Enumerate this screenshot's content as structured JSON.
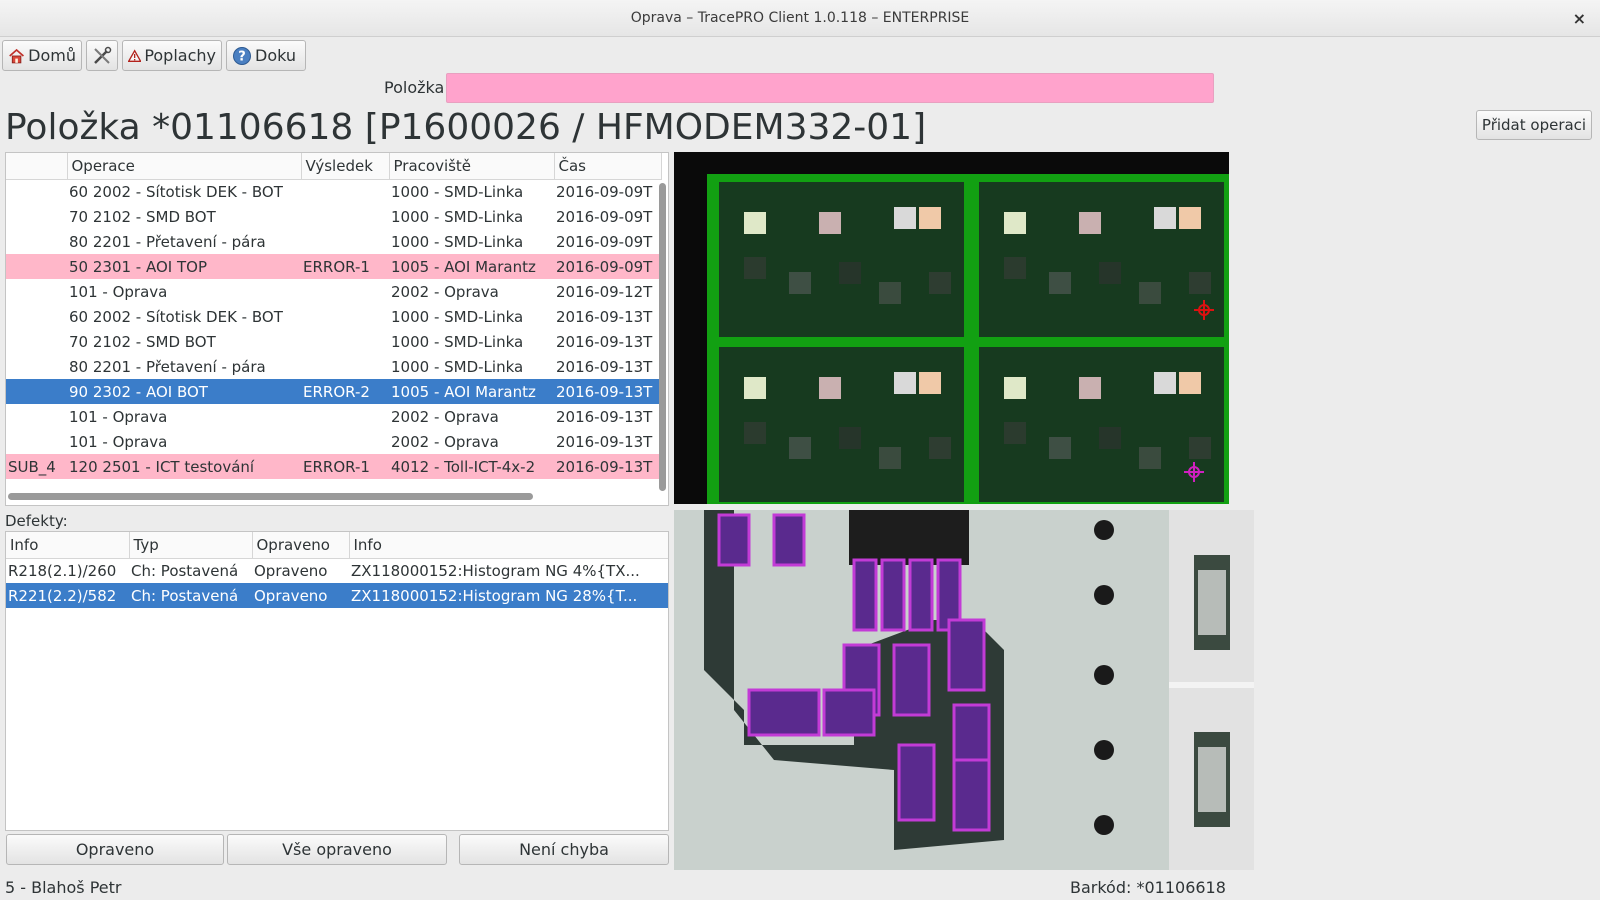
{
  "window": {
    "title": "Oprava – TracePRO Client 1.0.118 – ENTERPRISE",
    "close_glyph": "×"
  },
  "toolbar": {
    "home": {
      "label": "Domů",
      "icon": "home-icon"
    },
    "tools": {
      "label": "",
      "icon": "tools-icon"
    },
    "alarms": {
      "label": "Poplachy",
      "icon": "warning-icon"
    },
    "docs": {
      "label": "Doku",
      "icon": "help-icon"
    }
  },
  "search": {
    "label": "Položka",
    "value": ""
  },
  "item_title": "Položka *01106618 [P1600026 / HFMODEM332-01]",
  "add_operation_label": "Přidat operaci",
  "operations": {
    "columns": [
      "",
      "Operace",
      "Výsledek",
      "Pracoviště",
      "Čas"
    ],
    "rows": [
      {
        "c0": "",
        "op": "60 2002 - Sítotisk DEK - BOT",
        "res": "",
        "ws": "1000 - SMD-Linka",
        "time": "2016-09-09T",
        "state": "normal"
      },
      {
        "c0": "",
        "op": "70 2102 - SMD BOT",
        "res": "",
        "ws": "1000 - SMD-Linka",
        "time": "2016-09-09T",
        "state": "normal"
      },
      {
        "c0": "",
        "op": "80 2201 - Přetavení - pára",
        "res": "",
        "ws": "1000 - SMD-Linka",
        "time": "2016-09-09T",
        "state": "normal"
      },
      {
        "c0": "",
        "op": "50 2301 - AOI TOP",
        "res": "ERROR-1",
        "ws": "1005 - AOI Marantz",
        "time": "2016-09-09T",
        "state": "error"
      },
      {
        "c0": "",
        "op": " 101 - Oprava",
        "res": "",
        "ws": "2002 - Oprava",
        "time": "2016-09-12T",
        "state": "normal"
      },
      {
        "c0": "",
        "op": "60 2002 - Sítotisk DEK - BOT",
        "res": "",
        "ws": "1000 - SMD-Linka",
        "time": "2016-09-13T",
        "state": "normal"
      },
      {
        "c0": "",
        "op": "70 2102 - SMD BOT",
        "res": "",
        "ws": "1000 - SMD-Linka",
        "time": "2016-09-13T",
        "state": "normal"
      },
      {
        "c0": "",
        "op": "80 2201 - Přetavení - pára",
        "res": "",
        "ws": "1000 - SMD-Linka",
        "time": "2016-09-13T",
        "state": "normal"
      },
      {
        "c0": "",
        "op": "90 2302 - AOI BOT",
        "res": "ERROR-2",
        "ws": "1005 - AOI Marantz",
        "time": "2016-09-13T",
        "state": "selected"
      },
      {
        "c0": "",
        "op": " 101 - Oprava",
        "res": "",
        "ws": "2002 - Oprava",
        "time": "2016-09-13T",
        "state": "normal"
      },
      {
        "c0": "",
        "op": " 101 - Oprava",
        "res": "",
        "ws": "2002 - Oprava",
        "time": "2016-09-13T",
        "state": "normal"
      },
      {
        "c0": "SUB_4",
        "op": "120 2501 - ICT testování",
        "res": "ERROR-1",
        "ws": "4012 - Toll-ICT-4x-2",
        "time": "2016-09-13T",
        "state": "error"
      }
    ]
  },
  "defects": {
    "label": "Defekty:",
    "columns": [
      "Info",
      "Typ",
      "Opraveno",
      "Info"
    ],
    "rows": [
      {
        "info": "R218(2.1)/260",
        "type": "Ch: Postavená",
        "fixed": "Opraveno",
        "detail": "ZX118000152:Histogram NG 4%{TX...",
        "state": "normal"
      },
      {
        "info": "R221(2.2)/582",
        "type": "Ch: Postavená",
        "fixed": "Opraveno",
        "detail": "ZX118000152:Histogram NG 28%{T...",
        "state": "selected"
      }
    ]
  },
  "buttons": {
    "fixed": "Opraveno",
    "all_fixed": "Vše opraveno",
    "not_error": "Není chyba"
  },
  "status": {
    "user": "5 - Blahoš Petr",
    "barcode": "Barkód: *01106618"
  },
  "colors": {
    "error_row": "#ffb7c9",
    "selected_row": "#3b7dc9",
    "search_bg": "#ffa3cc",
    "pcb_green": "#14a314"
  }
}
